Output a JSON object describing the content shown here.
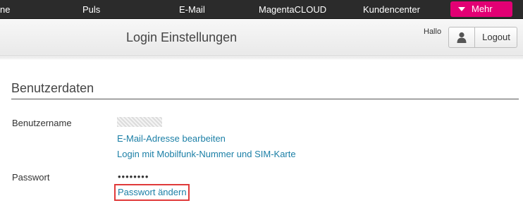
{
  "topnav": {
    "items": [
      {
        "label": "ne"
      },
      {
        "label": "Puls"
      },
      {
        "label": "E-Mail"
      },
      {
        "label": "MagentaCLOUD"
      },
      {
        "label": "Kundencenter"
      }
    ],
    "more_label": "Mehr",
    "accent_color": "#e20074"
  },
  "header": {
    "title": "Login Einstellungen",
    "greeting": "Hallo",
    "logout_label": "Logout",
    "user_icon": "user-icon"
  },
  "content": {
    "section_title": "Benutzerdaten",
    "username_label": "Benutzername",
    "username_value_state": "masked",
    "edit_email_link": "E-Mail-Adresse bearbeiten",
    "mobile_login_link": "Login mit Mobilfunk-Nummer und SIM-Karte",
    "password_label": "Passwort",
    "password_value": "••••••••",
    "change_password_link": "Passwort ändern",
    "highlight_color": "#e03a3a",
    "link_color": "#1b7fa6"
  }
}
